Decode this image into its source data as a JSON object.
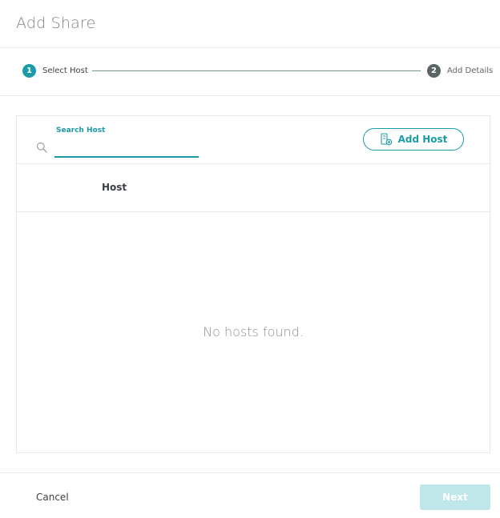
{
  "dialog": {
    "title": "Add Share"
  },
  "stepper": {
    "steps": [
      {
        "number": "1",
        "label": "Select Host",
        "state": "active"
      },
      {
        "number": "2",
        "label": "Add Details",
        "state": "inactive"
      }
    ]
  },
  "search": {
    "label": "Search Host",
    "value": "",
    "placeholder": ""
  },
  "toolbar": {
    "add_host_label": "Add Host",
    "add_host_icon": "server-plus-icon"
  },
  "table": {
    "columns": [
      "Host"
    ],
    "rows": [],
    "empty_message": "No hosts found."
  },
  "footer": {
    "cancel_label": "Cancel",
    "next_label": "Next",
    "next_disabled": true
  },
  "colors": {
    "accent": "#1a9ba7",
    "inactive_step": "#5d6468",
    "disabled_button": "#bfe6e9"
  }
}
